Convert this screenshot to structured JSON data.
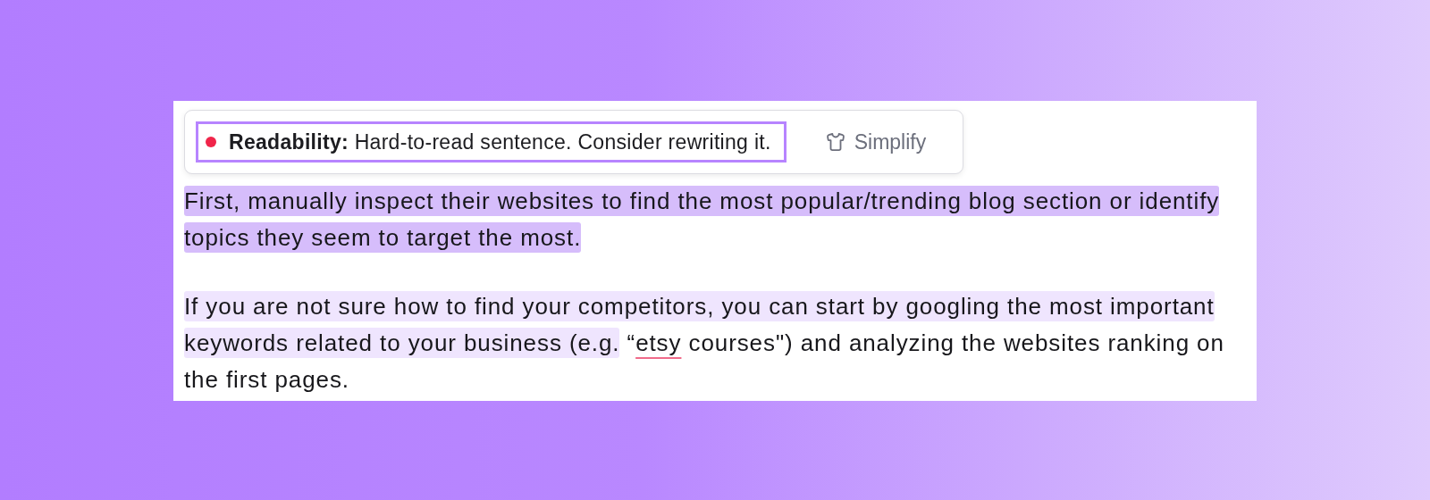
{
  "suggestion": {
    "color": "#f0254a",
    "message": "**Readability:** Hard-to-read sentence. Consider rewriting it.",
    "selected": true,
    "action": "Simplify"
  },
  "paragraphs": [
    {
      "segments": [
        {
          "text": "First, manually inspect their websites to find the most popular/trending blog section or identify topics they seem to target the most.",
          "color": "#d6bdfb",
          "flagged": false
        }
      ]
    },
    {
      "segments": [
        {
          "text": "If you are not sure how to find your competitors, you can start by googling the most important keywords related to your business (e.g.",
          "color": "#efe5fe",
          "flagged": false
        },
        {
          "text": " “",
          "flagged": false
        },
        {
          "text": "etsy",
          "flagged": true
        },
        {
          "text": " courses\") and analyzing the websites ranking on the first pages.",
          "flagged": false
        }
      ]
    }
  ]
}
